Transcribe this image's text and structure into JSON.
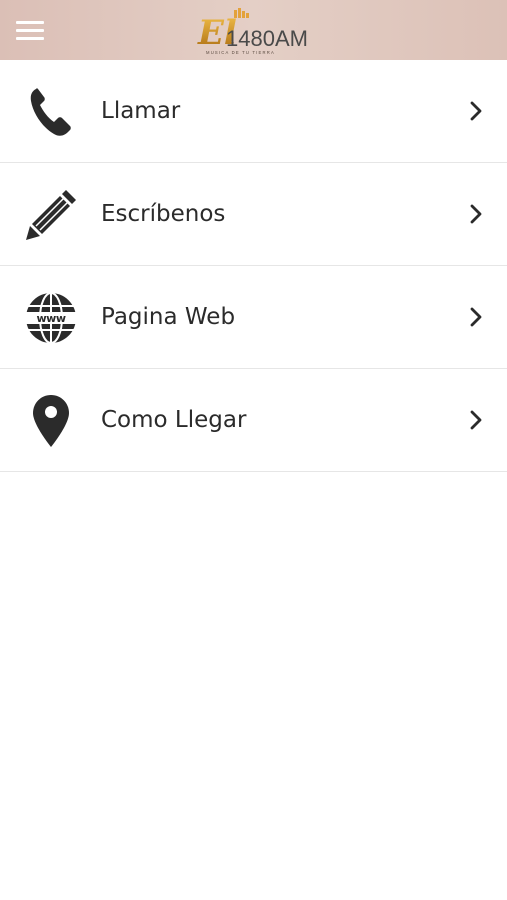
{
  "header": {
    "menu_icon": "hamburger-menu-icon",
    "logo_text_main": "El",
    "logo_text_number": "1480AM",
    "logo_tagline": "MUSICA DE TU TIERRA",
    "colors": {
      "bar": "#dfc6bc",
      "logo_gold": "#b8860b",
      "logo_orange": "#d98a2b"
    }
  },
  "menu": {
    "items": [
      {
        "label": "Llamar",
        "icon": "phone-icon"
      },
      {
        "label": "Escríbenos",
        "icon": "pencil-icon"
      },
      {
        "label": "Pagina Web",
        "icon": "globe-www-icon"
      },
      {
        "label": "Como Llegar",
        "icon": "map-pin-icon"
      }
    ],
    "chevron_icon": "chevron-right-icon",
    "colors": {
      "text": "#2b2b2b",
      "icon": "#2b2b2b",
      "divider": "#e6e6e6"
    }
  }
}
